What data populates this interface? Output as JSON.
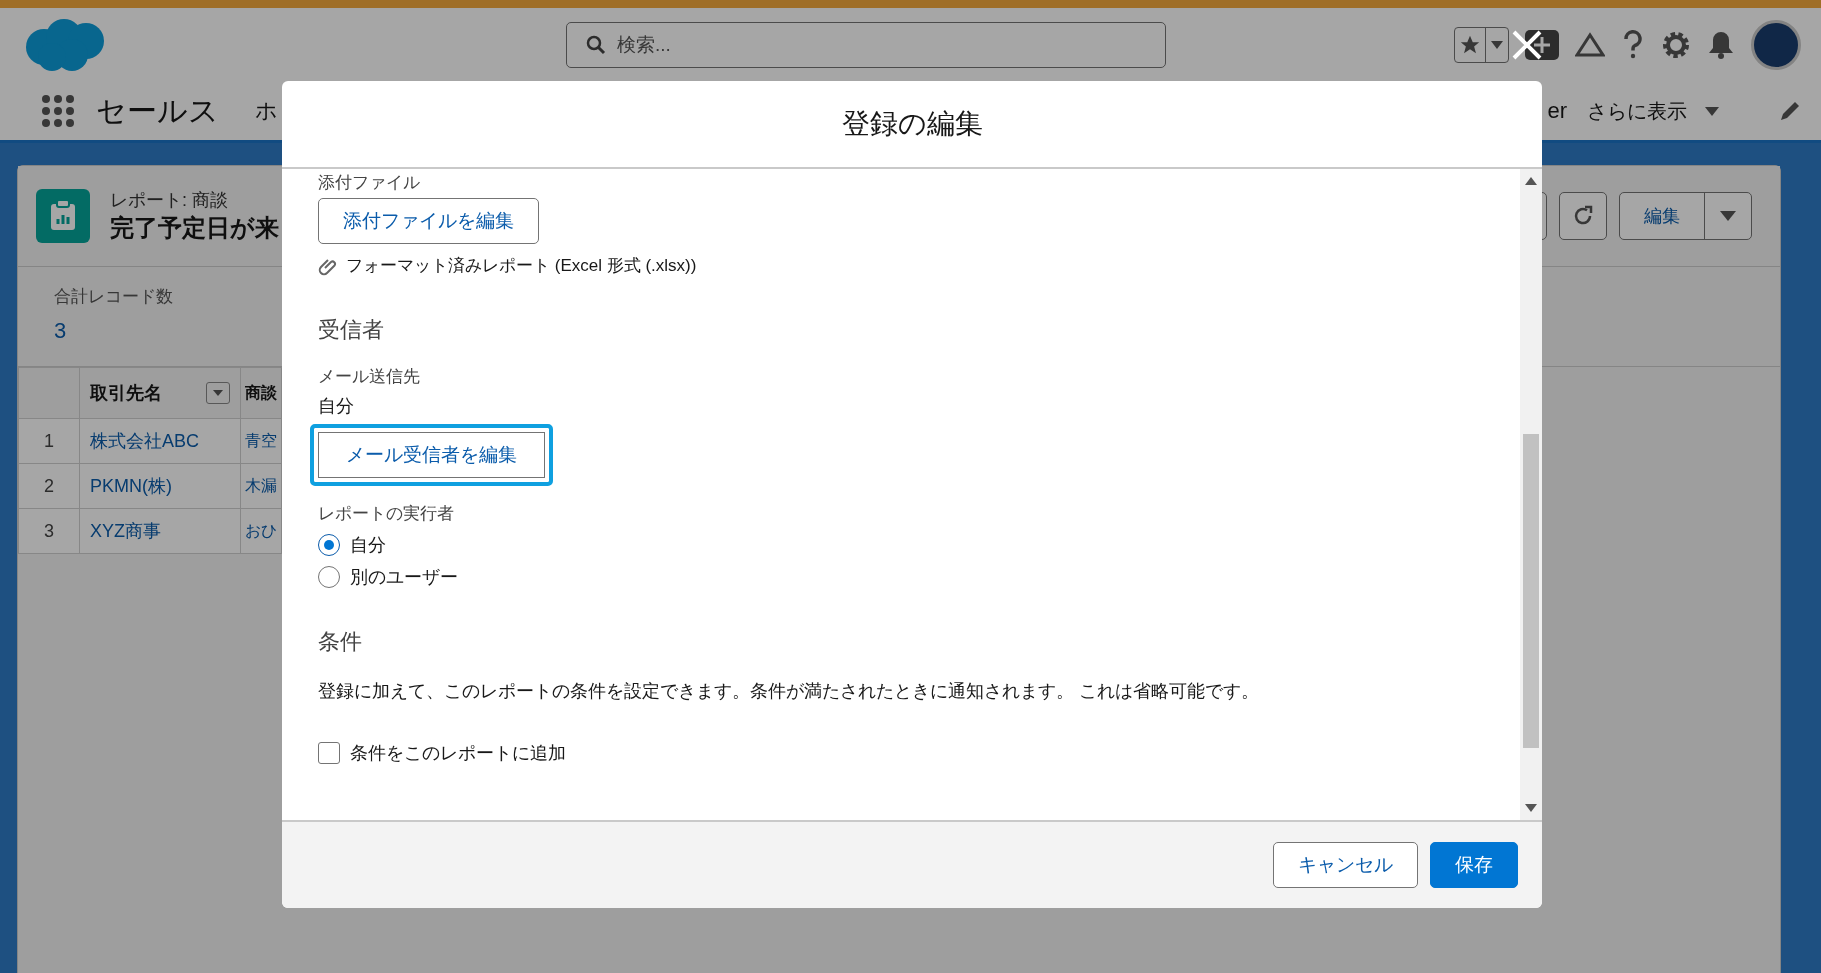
{
  "header": {
    "search": {
      "placeholder": "検索..."
    }
  },
  "nav": {
    "app_name": "セールス",
    "tabs": [
      {
        "label": "ホ"
      },
      {
        "label": "er"
      }
    ],
    "more": "さらに表示"
  },
  "report": {
    "type_label": "レポート: 商談",
    "title": "完了予定日が来",
    "edit_button": "編集"
  },
  "summary": {
    "label": "合計レコード数",
    "value": "3"
  },
  "table": {
    "columns": [
      "取引先名",
      "商談"
    ],
    "rows": [
      {
        "number": "1",
        "cells": [
          "株式会社ABC",
          "青空"
        ]
      },
      {
        "number": "2",
        "cells": [
          "PKMN(株)",
          "木漏"
        ]
      },
      {
        "number": "3",
        "cells": [
          "XYZ商事",
          "おひ"
        ]
      }
    ]
  },
  "modal": {
    "title": "登録の編集",
    "attachment": {
      "label": "添付ファイル",
      "button": "添付ファイルを編集",
      "file": "フォーマット済みレポート (Excel 形式 (.xlsx))"
    },
    "recipients": {
      "heading": "受信者",
      "send_to_label": "メール送信先",
      "send_to_value": "自分",
      "button": "メール受信者を編集",
      "focused": true
    },
    "runner": {
      "label": "レポートの実行者",
      "options": [
        {
          "label": "自分",
          "selected": true
        },
        {
          "label": "別のユーザー",
          "selected": false
        }
      ]
    },
    "conditions": {
      "heading": "条件",
      "description": "登録に加えて、このレポートの条件を設定できます。条件が満たされたときに通知されます。 これは省略可能です。",
      "checkbox": {
        "label": "条件をこのレポートに追加",
        "checked": false
      }
    },
    "footer": {
      "cancel": "キャンセル",
      "save": "保存"
    }
  }
}
